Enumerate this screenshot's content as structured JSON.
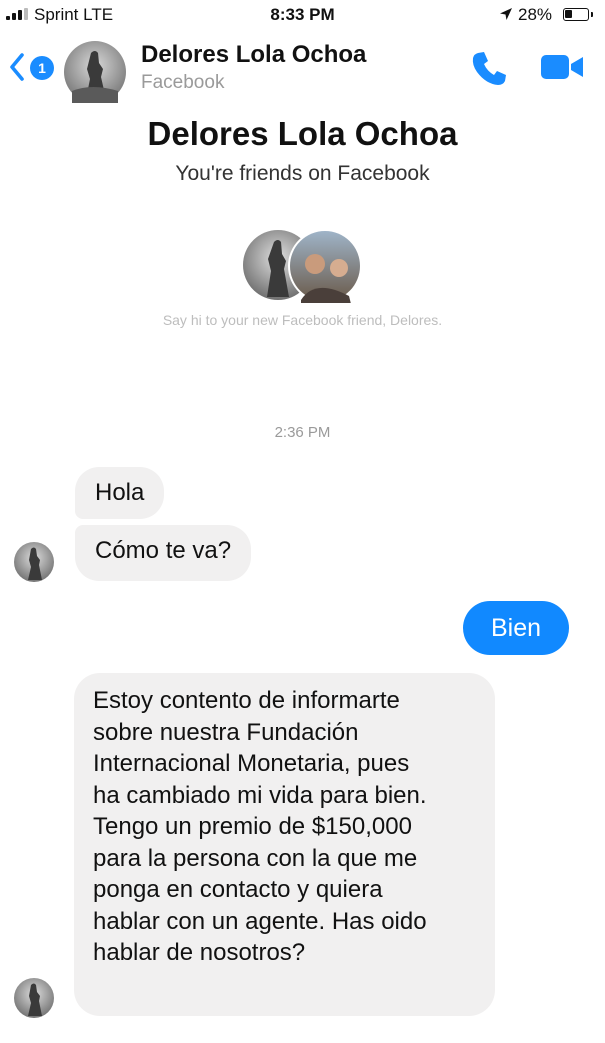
{
  "status_bar": {
    "carrier": "Sprint LTE",
    "time": "8:33 PM",
    "battery": "28%",
    "signal_bars": 3
  },
  "header": {
    "back_badge": "1",
    "name": "Delores Lola Ochoa",
    "subtitle": "Facebook",
    "icons": [
      "back-chevron-icon",
      "phone-icon",
      "video-camera-icon"
    ],
    "accent_color": "#1a8cff"
  },
  "intro": {
    "name": "Delores Lola Ochoa",
    "subtitle": "You're friends on Facebook",
    "hint": "Say hi to your new Facebook friend, Delores."
  },
  "conversation": {
    "timestamp": "2:36 PM",
    "messages": [
      {
        "sender": "Delores Lola Ochoa",
        "text": "Hola"
      },
      {
        "sender": "Delores Lola Ochoa",
        "text": "Cómo te va?"
      },
      {
        "sender": "me",
        "text": "Bien"
      },
      {
        "sender": "Delores Lola Ochoa",
        "text": "Estoy contento de informarte\nsobre nuestra Fundación\nInternacional Monetaria, pues\nha cambiado mi vida para bien.\nTengo un premio de $150,000\npara la persona con la que me\nponga en contacto y quiera\nhablar con un agente. Has oido\nhablar de nosotros?"
      }
    ],
    "outgoing_color": "#1189ff",
    "incoming_color": "#f1f0f0"
  }
}
